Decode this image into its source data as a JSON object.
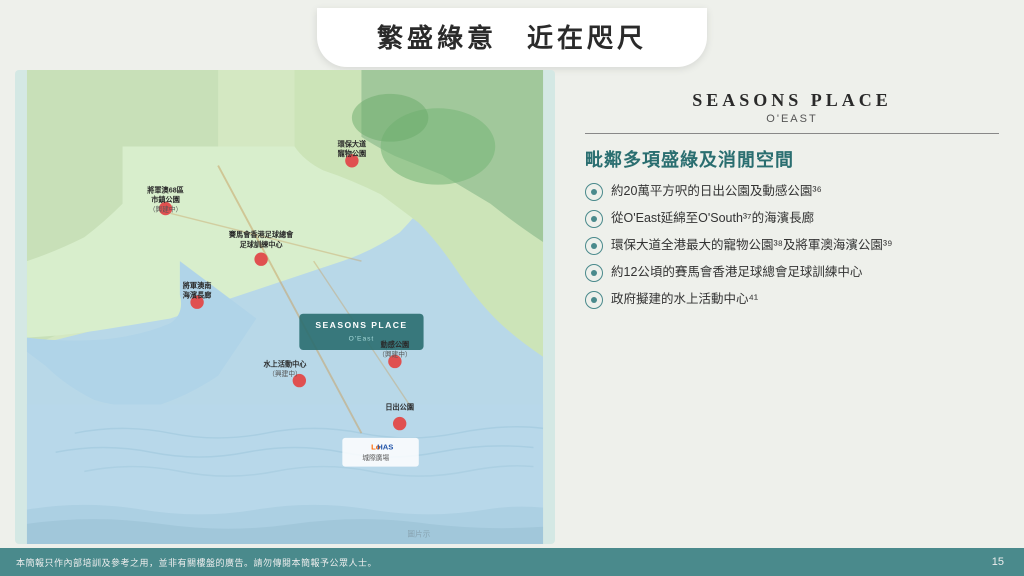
{
  "header": {
    "title": "繁盛綠意　近在咫尺"
  },
  "brand": {
    "name": "SEASONS PLACE",
    "sub": "O'EAST"
  },
  "section": {
    "title": "毗鄰多項盛綠及消閒空間"
  },
  "features": [
    {
      "text": "約20萬平方呎的日出公園及動感公園³⁶"
    },
    {
      "text": "從O'East延綿至O'South³⁷的海濱長廊"
    },
    {
      "text": "環保大道全港最大的寵物公園³⁸及將軍澳海濱公園³⁹"
    },
    {
      "text": "約12公頃的賽馬會香港足球總會足球訓練中心"
    },
    {
      "text": "政府擬建的水上活動中心⁴¹"
    }
  ],
  "map_labels": [
    {
      "id": "label1",
      "text": "環保大道\n寵物公園"
    },
    {
      "id": "label2",
      "text": "將軍澳68區\n市鎮公園\n（興建中）"
    },
    {
      "id": "label3",
      "text": "賽馬會香港足球總會\n足球訓練中心"
    },
    {
      "id": "label4",
      "text": "將軍澳南\n海濱長廊"
    },
    {
      "id": "label5",
      "text": "SEASONS PLACE\nO'East"
    },
    {
      "id": "label6",
      "text": "水上活動中心\n（興建中）"
    },
    {
      "id": "label7",
      "text": "動感公園\n（興建中）"
    },
    {
      "id": "label8",
      "text": "日出公園"
    },
    {
      "id": "label9",
      "text": "圖片示"
    }
  ],
  "footer": {
    "disclaimer": "本簡報只作內部培訓及參考之用，並非有關樓盤的廣告。請勿傳閱本簡報予公眾人士。",
    "page_number": "15"
  }
}
